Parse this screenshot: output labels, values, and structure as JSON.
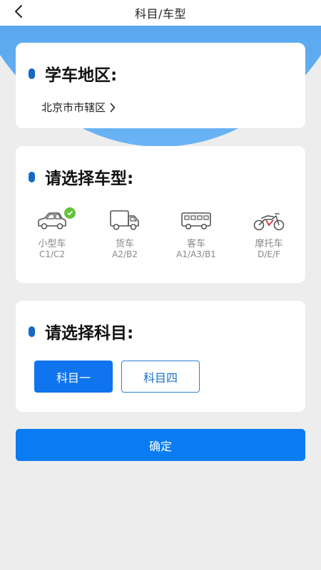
{
  "header": {
    "title": "科目/车型",
    "back_icon": "chevron-left-icon"
  },
  "region_card": {
    "title": "学车地区:",
    "value": "北京市市辖区",
    "chevron_icon": "chevron-right-icon"
  },
  "vehicle_card": {
    "title": "请选择车型:",
    "vehicles": [
      {
        "name": "小型车",
        "code": "C1/C2",
        "icon": "car-icon",
        "selected": true
      },
      {
        "name": "货车",
        "code": "A2/B2",
        "icon": "truck-icon",
        "selected": false
      },
      {
        "name": "客车",
        "code": "A1/A3/B1",
        "icon": "bus-icon",
        "selected": false
      },
      {
        "name": "摩托车",
        "code": "D/E/F",
        "icon": "motorcycle-icon",
        "selected": false
      }
    ]
  },
  "subject_card": {
    "title": "请选择科目:",
    "options": [
      {
        "label": "科目一",
        "selected": true
      },
      {
        "label": "科目四",
        "selected": false
      }
    ]
  },
  "confirm_label": "确定",
  "colors": {
    "primary": "#0f74ee",
    "header_band": "#3c8fe6",
    "check": "#64c23c",
    "dot": "#1569c7"
  }
}
